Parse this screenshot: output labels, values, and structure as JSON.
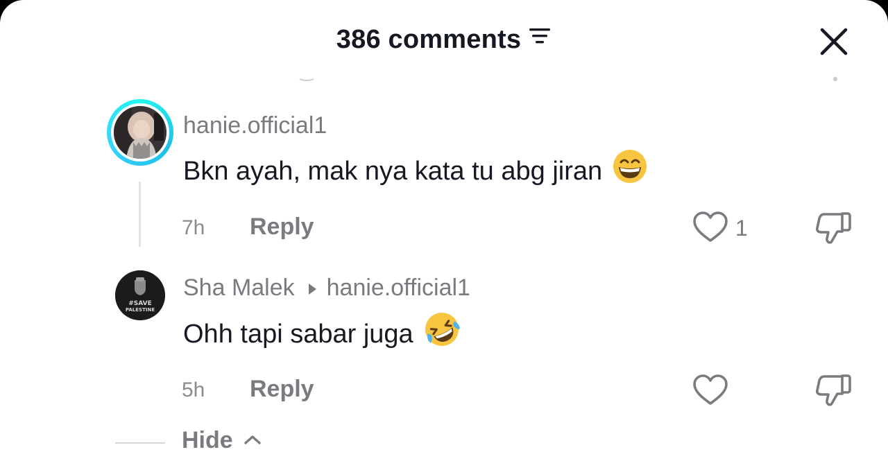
{
  "header": {
    "title": "386 comments"
  },
  "comments": [
    {
      "username": "hanie.official1",
      "text": "Bkn ayah, mak nya kata tu abg jiran",
      "emoji": "grinning-face-with-smiling-eyes",
      "time": "7h",
      "reply_label": "Reply",
      "like_count": "1"
    },
    {
      "username": "Sha Malek",
      "reply_to": "hanie.official1",
      "text": "Ohh tapi sabar juga",
      "emoji": "rolling-on-the-floor-laughing",
      "avatar_text": [
        "#SAVE",
        "PALESTINE"
      ],
      "time": "5h",
      "reply_label": "Reply",
      "like_count": ""
    }
  ],
  "footer": {
    "hide_label": "Hide"
  },
  "colors": {
    "text_primary": "#161823",
    "text_secondary": "#7a7a80",
    "ring_accent": "#25f4ee",
    "emoji_yellow": "#f7c53f"
  }
}
